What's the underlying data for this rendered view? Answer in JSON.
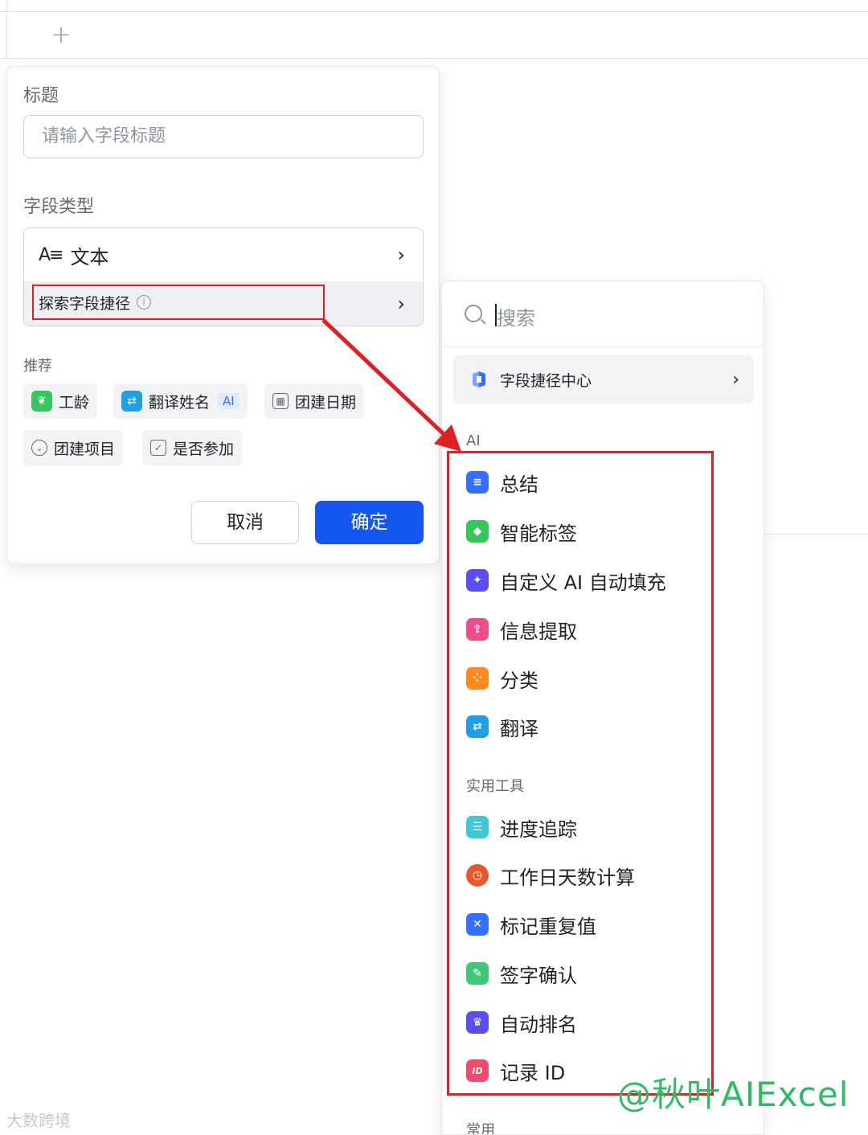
{
  "form": {
    "title_label": "标题",
    "title_placeholder": "请输入字段标题",
    "type_label": "字段类型",
    "type_icon_text": "A≡",
    "type_value": "文本",
    "explore_label": "探索字段捷径",
    "recommend_label": "推荐",
    "chips": [
      {
        "label": "工龄",
        "icon": "seedling-icon",
        "color": "#34c759"
      },
      {
        "label": "翻译姓名",
        "icon": "translate-icon",
        "color": "#1ea0e6",
        "tag": "AI"
      },
      {
        "label": "团建日期",
        "icon": "calendar-icon"
      },
      {
        "label": "团建项目",
        "icon": "option-circle-icon"
      },
      {
        "label": "是否参加",
        "icon": "checkbox-icon"
      }
    ],
    "cancel_label": "取消",
    "confirm_label": "确定"
  },
  "menu": {
    "search_placeholder": "搜索",
    "center_label": "字段捷径中心",
    "sections": [
      {
        "title": "AI",
        "items": [
          {
            "label": "总结",
            "icon": "summary-icon",
            "color": "#3370ff"
          },
          {
            "label": "智能标签",
            "icon": "tag-icon",
            "color": "#34c759"
          },
          {
            "label": "自定义 AI 自动填充",
            "icon": "sparkle-icon",
            "color": "#5b4ef0"
          },
          {
            "label": "信息提取",
            "icon": "extract-icon",
            "color": "#f04d8c"
          },
          {
            "label": "分类",
            "icon": "category-icon",
            "color": "#ff8a1f"
          },
          {
            "label": "翻译",
            "icon": "translate-icon",
            "color": "#1ea0e6"
          }
        ]
      },
      {
        "title": "实用工具",
        "items": [
          {
            "label": "进度追踪",
            "icon": "progress-icon",
            "color": "#3ec7d6"
          },
          {
            "label": "工作日天数计算",
            "icon": "clock-icon",
            "color": "#e8582a"
          },
          {
            "label": "标记重复值",
            "icon": "pin-icon",
            "color": "#3370ff"
          },
          {
            "label": "签字确认",
            "icon": "signature-icon",
            "color": "#3ec97a"
          },
          {
            "label": "自动排名",
            "icon": "ranking-icon",
            "color": "#5b4ef0"
          },
          {
            "label": "记录 ID",
            "icon": "id-icon",
            "color": "#f04d6c"
          }
        ]
      },
      {
        "title": "常用"
      }
    ]
  },
  "watermark": {
    "main": "@秋叶AIExcel",
    "corner": "大数跨境"
  },
  "colors": {
    "primary": "#1456f0",
    "highlight_red": "#e02020",
    "watermark_green": "#2dbb63"
  }
}
